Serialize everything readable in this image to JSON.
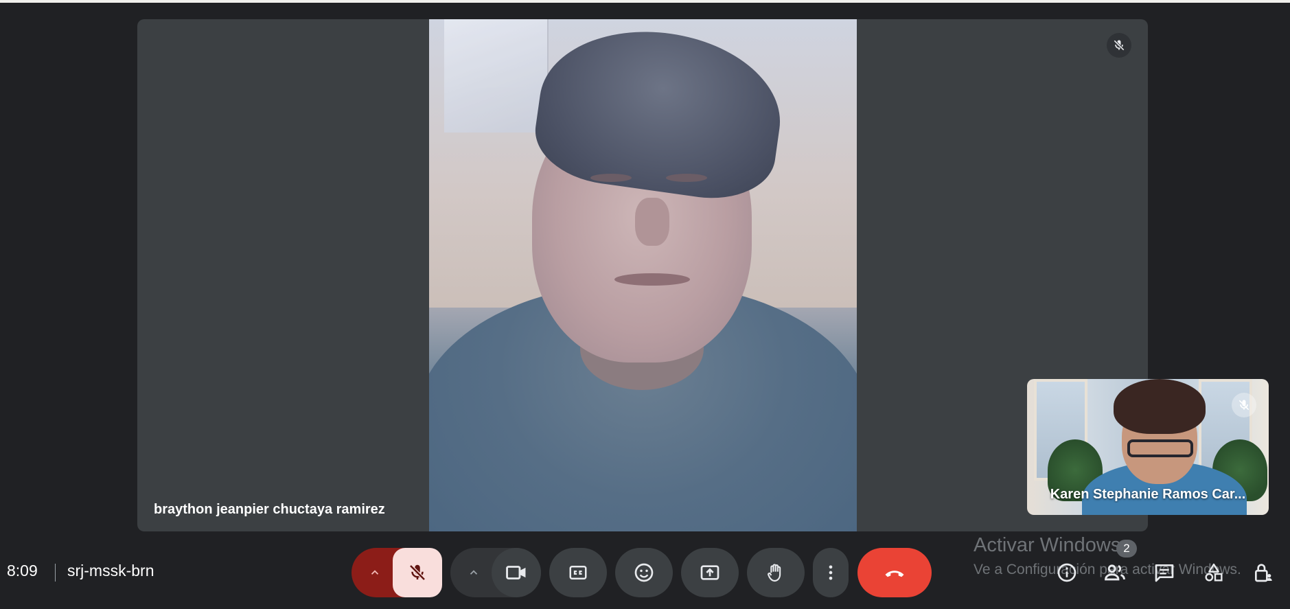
{
  "main_tile": {
    "participant_name": "braython jeanpier chuctaya ramirez"
  },
  "self_tile": {
    "participant_name": "Karen Stephanie Ramos Car..."
  },
  "meeting": {
    "time": "8:09",
    "code": "srj-mssk-brn"
  },
  "controls": {
    "mic": {
      "icon": "mic-off-icon",
      "state": "muted"
    },
    "camera": {
      "icon": "video-camera-icon"
    },
    "captions": {
      "icon": "closed-captions-icon"
    },
    "reactions": {
      "icon": "emoji-icon"
    },
    "present": {
      "icon": "present-screen-icon"
    },
    "raise_hand": {
      "icon": "raise-hand-icon"
    },
    "more": {
      "icon": "more-vert-icon"
    },
    "leave": {
      "icon": "end-call-icon"
    }
  },
  "side_panel": {
    "people_badge": "2"
  },
  "os_watermark": {
    "line1": "Activar Windows",
    "line2": "Ve a Configuración para activar Windows."
  },
  "colors": {
    "background": "#202124",
    "tile": "#3c4043",
    "end_call": "#ea4335",
    "mic_muted_bg": "#f9dedc"
  }
}
